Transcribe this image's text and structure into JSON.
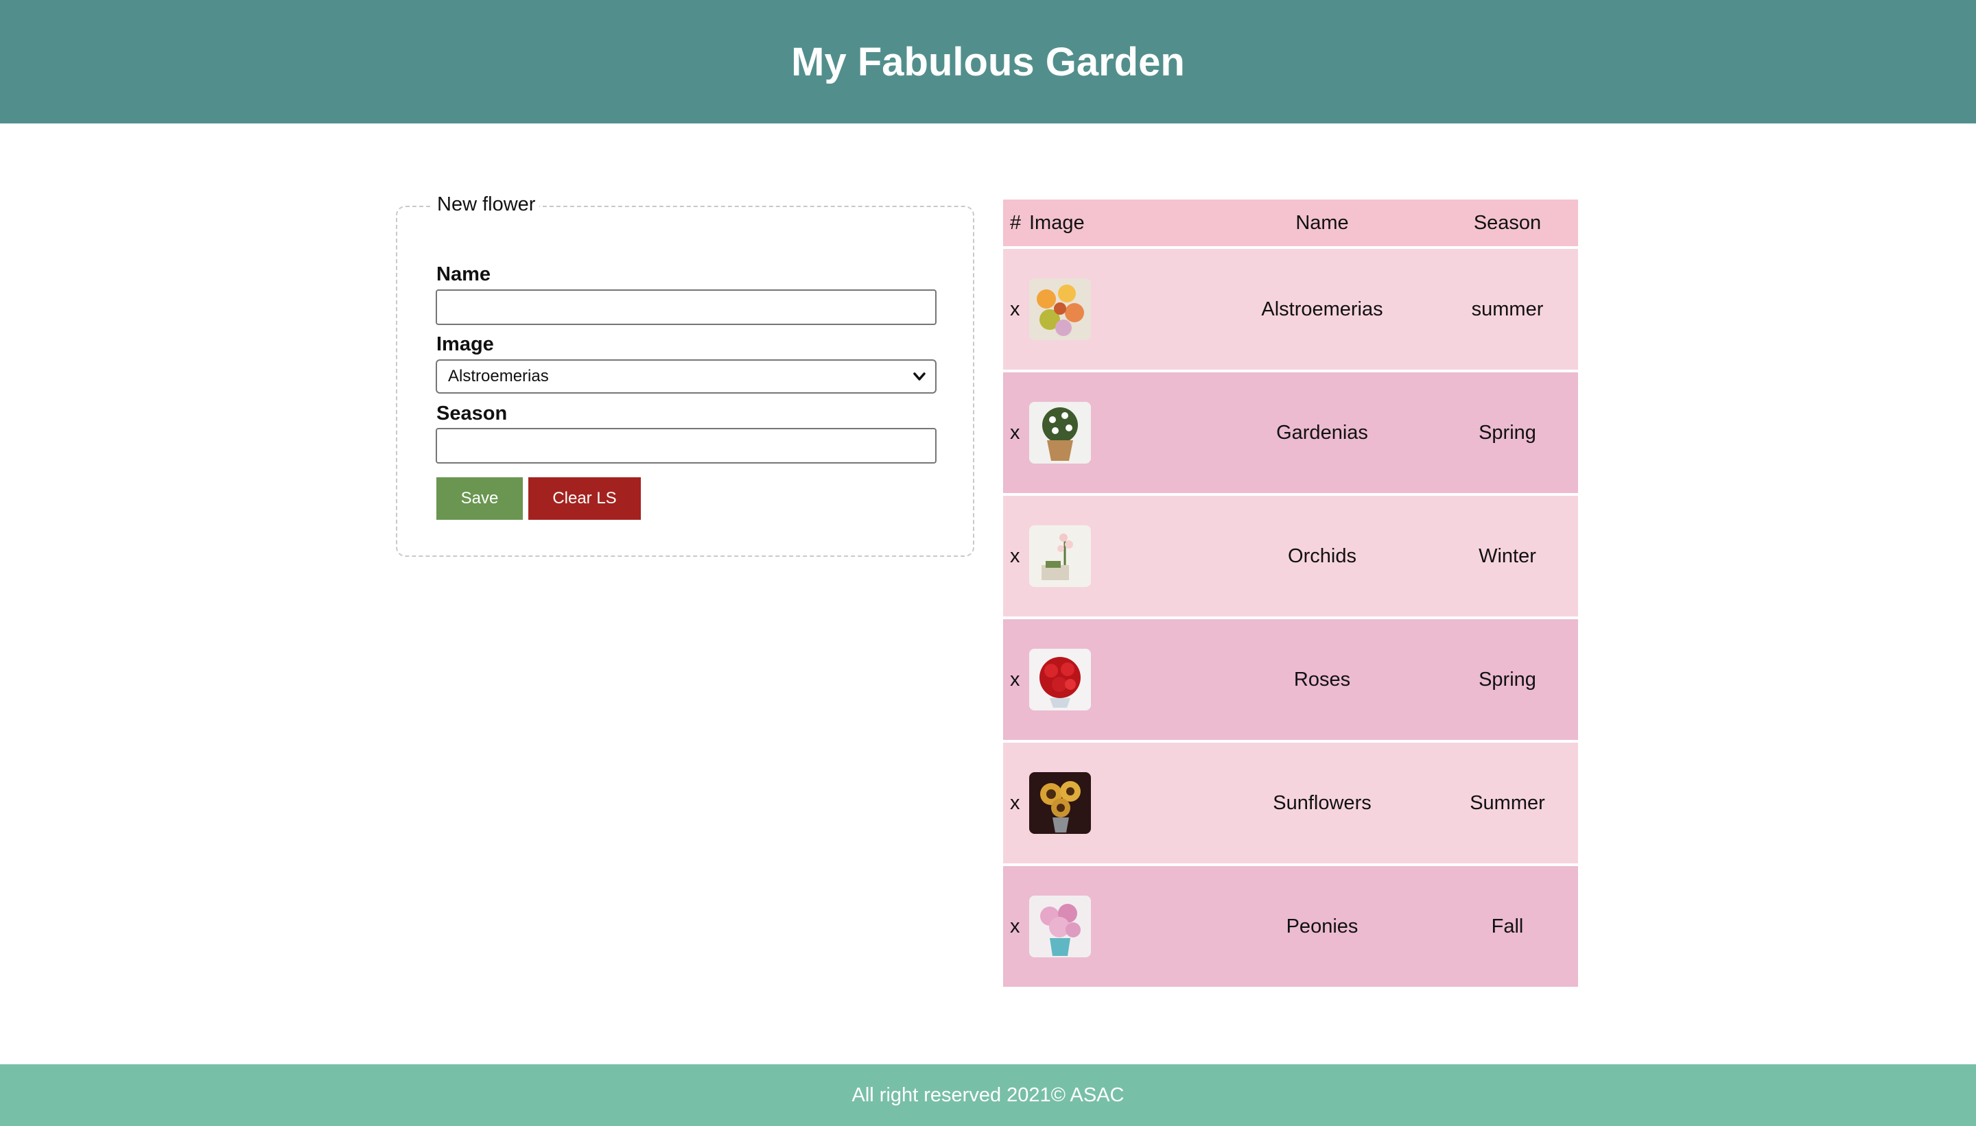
{
  "header": {
    "title": "My Fabulous Garden"
  },
  "form": {
    "legend": "New flower",
    "name_label": "Name",
    "name_value": "",
    "image_label": "Image",
    "image_selected": "Alstroemerias",
    "season_label": "Season",
    "season_value": "",
    "save_label": "Save",
    "clear_label": "Clear LS"
  },
  "table": {
    "headers": {
      "hash": "#",
      "image": "Image",
      "name": "Name",
      "season": "Season"
    },
    "rows": [
      {
        "remove": "x",
        "name": "Alstroemerias",
        "season": "summer",
        "image_icon": "alstroemeria-image"
      },
      {
        "remove": "x",
        "name": "Gardenias",
        "season": "Spring",
        "image_icon": "gardenia-image"
      },
      {
        "remove": "x",
        "name": "Orchids",
        "season": "Winter",
        "image_icon": "orchid-image"
      },
      {
        "remove": "x",
        "name": "Roses",
        "season": "Spring",
        "image_icon": "rose-image"
      },
      {
        "remove": "x",
        "name": "Sunflowers",
        "season": "Summer",
        "image_icon": "sunflower-image"
      },
      {
        "remove": "x",
        "name": "Peonies",
        "season": "Fall",
        "image_icon": "peony-image"
      }
    ]
  },
  "footer": {
    "text": "All right reserved 2021© ASAC"
  },
  "colors": {
    "header_bg": "#528f8c",
    "footer_bg": "#78bfa8",
    "save_button": "#6a9651",
    "clear_button": "#a3221f",
    "table_header": "#f4c3cf",
    "row_light": "#f6d4de",
    "row_dark": "#ecbbd0"
  }
}
